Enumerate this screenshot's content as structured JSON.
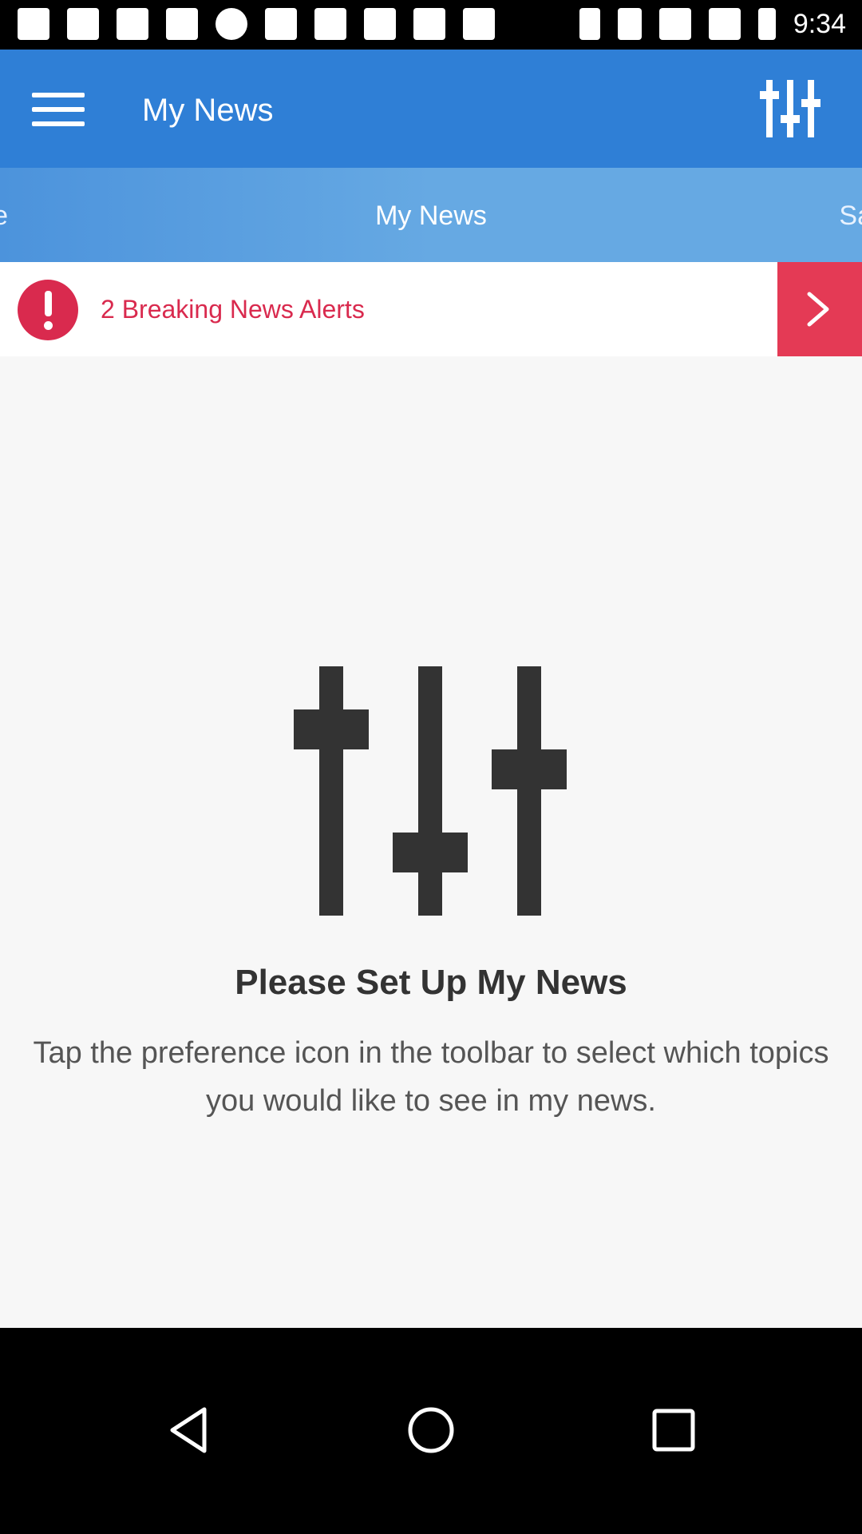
{
  "status_bar": {
    "time": "9:34",
    "left_icons": [
      "app-notification-icon",
      "app-notification-icon",
      "message-icon",
      "app-notification-icon",
      "signal-icon",
      "satellite-icon",
      "lock-icon",
      "game-icon",
      "inbox-icon",
      "briefcase-icon"
    ],
    "right_icons": [
      "bluetooth-icon",
      "vibrate-icon",
      "wifi-icon",
      "cellular-icon",
      "battery-icon"
    ]
  },
  "app_bar": {
    "title": "My News",
    "menu_icon": "hamburger-menu-icon",
    "preferences_icon": "sliders-icon",
    "color": "#2f7fd6"
  },
  "tabs": {
    "items": [
      {
        "label": "r Me"
      },
      {
        "label": "My News",
        "selected": true
      },
      {
        "label": "Sav"
      }
    ]
  },
  "alert": {
    "text": "2 Breaking News Alerts",
    "icon": "exclamation-circle-icon",
    "arrow_icon": "chevron-right-icon",
    "color": "#d92a4e"
  },
  "empty_state": {
    "icon": "sliders-icon",
    "title": "Please Set Up My News",
    "description": "Tap the preference icon in the toolbar to select which topics you would like to see in my news."
  },
  "nav_bar": {
    "back_icon": "back-triangle-icon",
    "home_icon": "home-circle-icon",
    "recents_icon": "recents-square-icon"
  }
}
